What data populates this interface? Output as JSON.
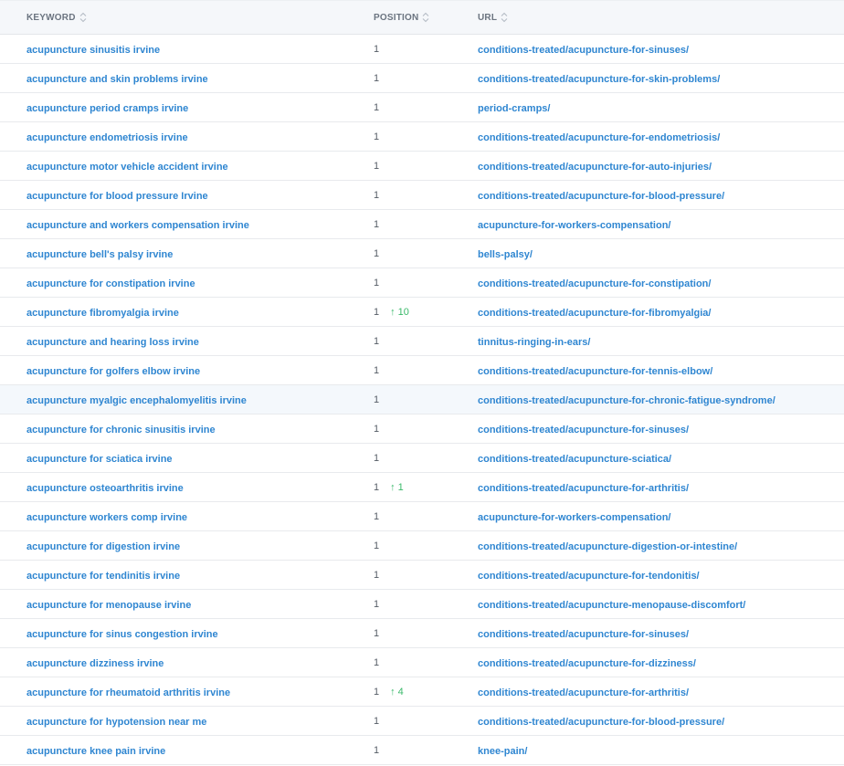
{
  "header": {
    "keyword": "KEYWORD",
    "position": "POSITION",
    "url": "URL"
  },
  "rows": [
    {
      "keyword": "acupuncture sinusitis irvine",
      "position": "1",
      "change": "",
      "url": "conditions-treated/acupuncture-for-sinuses/"
    },
    {
      "keyword": "acupuncture and skin problems irvine",
      "position": "1",
      "change": "",
      "url": "conditions-treated/acupuncture-for-skin-problems/"
    },
    {
      "keyword": "acupuncture period cramps irvine",
      "position": "1",
      "change": "",
      "url": "period-cramps/"
    },
    {
      "keyword": "acupuncture endometriosis irvine",
      "position": "1",
      "change": "",
      "url": "conditions-treated/acupuncture-for-endometriosis/"
    },
    {
      "keyword": "acupuncture motor vehicle accident irvine",
      "position": "1",
      "change": "",
      "url": "conditions-treated/acupuncture-for-auto-injuries/"
    },
    {
      "keyword": "acupuncture for blood pressure Irvine",
      "position": "1",
      "change": "",
      "url": "conditions-treated/acupuncture-for-blood-pressure/"
    },
    {
      "keyword": "acupuncture and workers compensation irvine",
      "position": "1",
      "change": "",
      "url": "acupuncture-for-workers-compensation/"
    },
    {
      "keyword": "acupuncture bell's palsy irvine",
      "position": "1",
      "change": "",
      "url": "bells-palsy/"
    },
    {
      "keyword": "acupuncture for constipation irvine",
      "position": "1",
      "change": "",
      "url": "conditions-treated/acupuncture-for-constipation/"
    },
    {
      "keyword": "acupuncture fibromyalgia irvine",
      "position": "1",
      "change": "10",
      "url": "conditions-treated/acupuncture-for-fibromyalgia/"
    },
    {
      "keyword": "acupuncture and hearing loss irvine",
      "position": "1",
      "change": "",
      "url": "tinnitus-ringing-in-ears/"
    },
    {
      "keyword": "acupuncture for golfers elbow irvine",
      "position": "1",
      "change": "",
      "url": "conditions-treated/acupuncture-for-tennis-elbow/"
    },
    {
      "keyword": "acupuncture myalgic encephalomyelitis irvine",
      "position": "1",
      "change": "",
      "url": "conditions-treated/acupuncture-for-chronic-fatigue-syndrome/"
    },
    {
      "keyword": "acupuncture for chronic sinusitis irvine",
      "position": "1",
      "change": "",
      "url": "conditions-treated/acupuncture-for-sinuses/"
    },
    {
      "keyword": "acupuncture for sciatica irvine",
      "position": "1",
      "change": "",
      "url": "conditions-treated/acupuncture-sciatica/"
    },
    {
      "keyword": "acupuncture osteoarthritis irvine",
      "position": "1",
      "change": "1",
      "url": "conditions-treated/acupuncture-for-arthritis/"
    },
    {
      "keyword": "acupuncture workers comp irvine",
      "position": "1",
      "change": "",
      "url": "acupuncture-for-workers-compensation/"
    },
    {
      "keyword": "acupuncture for digestion irvine",
      "position": "1",
      "change": "",
      "url": "conditions-treated/acupuncture-digestion-or-intestine/"
    },
    {
      "keyword": "acupuncture for tendinitis irvine",
      "position": "1",
      "change": "",
      "url": "conditions-treated/acupuncture-for-tendonitis/"
    },
    {
      "keyword": "acupuncture for menopause irvine",
      "position": "1",
      "change": "",
      "url": "conditions-treated/acupuncture-menopause-discomfort/"
    },
    {
      "keyword": "acupuncture for sinus congestion irvine",
      "position": "1",
      "change": "",
      "url": "conditions-treated/acupuncture-for-sinuses/"
    },
    {
      "keyword": "acupuncture dizziness irvine",
      "position": "1",
      "change": "",
      "url": "conditions-treated/acupuncture-for-dizziness/"
    },
    {
      "keyword": "acupuncture for rheumatoid arthritis irvine",
      "position": "1",
      "change": "4",
      "url": "conditions-treated/acupuncture-for-arthritis/"
    },
    {
      "keyword": "acupuncture for hypotension near me",
      "position": "1",
      "change": "",
      "url": "conditions-treated/acupuncture-for-blood-pressure/"
    },
    {
      "keyword": "acupuncture knee pain irvine",
      "position": "1",
      "change": "",
      "url": "knee-pain/"
    }
  ],
  "colors": {
    "link": "#2f86d1",
    "positive_change": "#3ab96a",
    "header_bg": "#f5f7fa"
  },
  "icons": {
    "sort": "sort-icon",
    "change": "arrow-up-icon"
  }
}
